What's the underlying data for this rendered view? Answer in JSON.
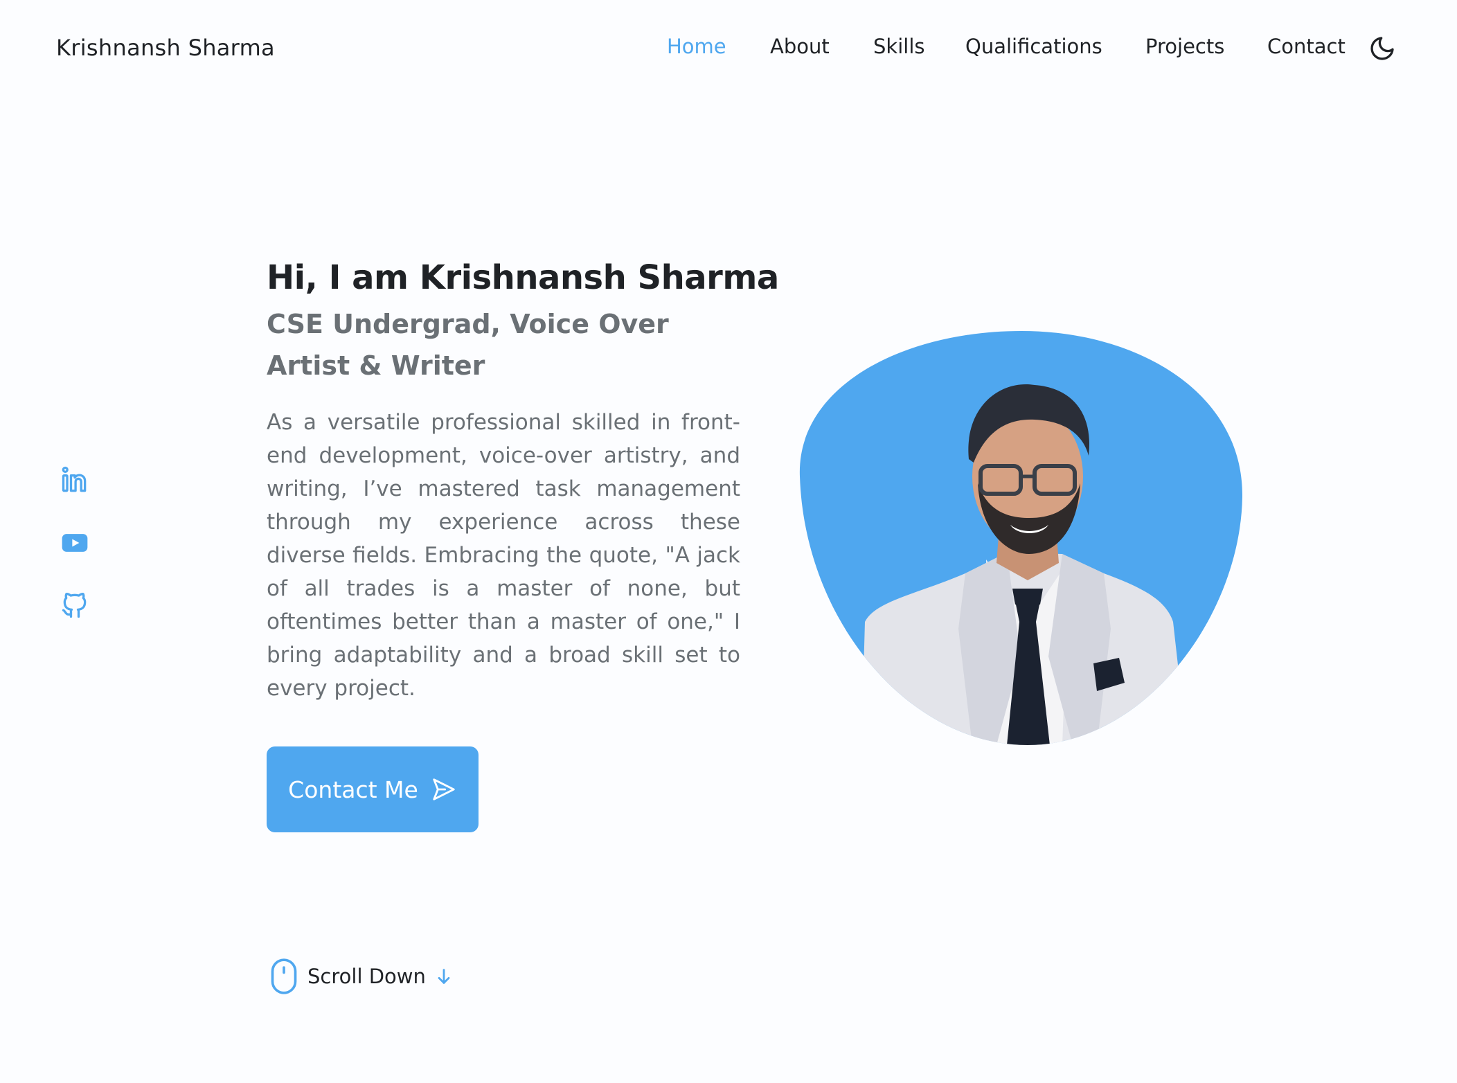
{
  "header": {
    "logo": "Krishnansh Sharma",
    "nav": [
      {
        "label": "Home",
        "active": true
      },
      {
        "label": "About",
        "active": false
      },
      {
        "label": "Skills",
        "active": false
      },
      {
        "label": "Qualifications",
        "active": false
      },
      {
        "label": "Projects",
        "active": false
      },
      {
        "label": "Contact",
        "active": false
      }
    ],
    "theme_toggle_icon": "moon-icon"
  },
  "social": [
    {
      "icon": "linkedin-icon"
    },
    {
      "icon": "youtube-icon"
    },
    {
      "icon": "github-icon"
    }
  ],
  "hero": {
    "title": "Hi, I am Krishnansh Sharma",
    "subtitle": "CSE Undergrad, Voice Over Artist & Writer",
    "description": "As a versatile professional skilled in front-end development, voice-over artistry, and writing, I’ve mastered task management through my experience across these diverse fields. Embracing the quote, \"A jack of all trades is a master of none, but oftentimes better than a master of one,\" I bring adaptability and a broad skill set to every project.",
    "cta_label": "Contact Me",
    "cta_icon": "send-icon"
  },
  "scroll": {
    "label": "Scroll Down",
    "mouse_icon": "mouse-icon",
    "arrow_icon": "arrow-down-icon"
  },
  "colors": {
    "accent": "#4fa7ef",
    "text_dark": "#1f2226",
    "text_muted": "#6a7075",
    "background": "#fcfdff"
  }
}
